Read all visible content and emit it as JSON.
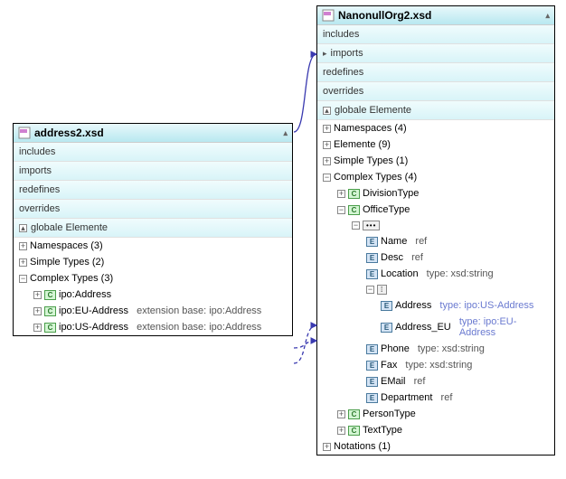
{
  "left": {
    "title": "address2.xsd",
    "sections": [
      "includes",
      "imports",
      "redefines",
      "overrides"
    ],
    "globale": "globale Elemente",
    "rows": {
      "namespaces": "Namespaces (3)",
      "simpleTypes": "Simple Types (2)",
      "complexTypes": "Complex Types (3)",
      "ct1": "ipo:Address",
      "ct2_name": "ipo:EU-Address",
      "ct2_ext": "extension base: ipo:Address",
      "ct3_name": "ipo:US-Address",
      "ct3_ext": "extension base: ipo:Address"
    }
  },
  "right": {
    "title": "NanonullOrg2.xsd",
    "sections": [
      "includes",
      "imports",
      "redefines",
      "overrides"
    ],
    "globale": "globale Elemente",
    "rows": {
      "namespaces": "Namespaces (4)",
      "elemente": "Elemente (9)",
      "simpleTypes": "Simple Types (1)",
      "complexTypes": "Complex Types (4)",
      "divisionType": "DivisionType",
      "officeType": "OfficeType",
      "name": "Name",
      "name_type": "ref",
      "desc": "Desc",
      "desc_type": "ref",
      "location": "Location",
      "location_type": "type: xsd:string",
      "address": "Address",
      "address_type": "type: ipo:US-Address",
      "addressEU": "Address_EU",
      "addressEU_type": "type: ipo:EU-Address",
      "phone": "Phone",
      "phone_type": "type: xsd:string",
      "fax": "Fax",
      "fax_type": "type: xsd:string",
      "email": "EMail",
      "email_type": "ref",
      "department": "Department",
      "department_type": "ref",
      "personType": "PersonType",
      "textType": "TextType",
      "notations": "Notations (1)"
    }
  }
}
